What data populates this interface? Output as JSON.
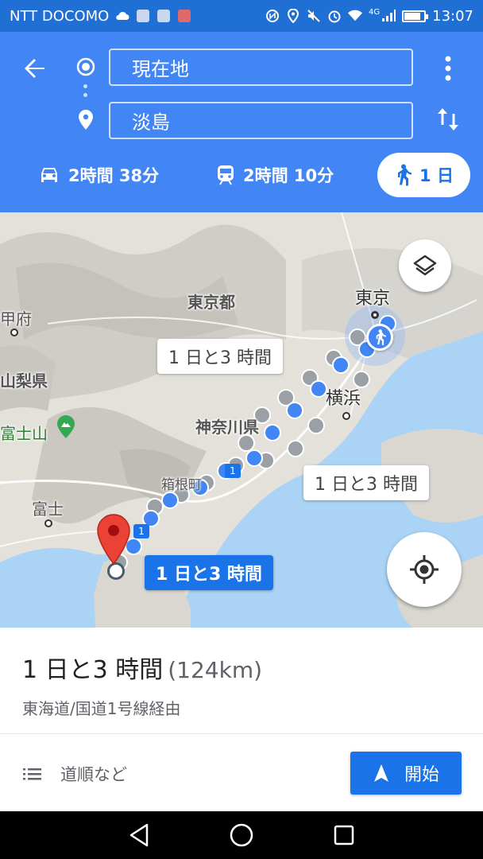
{
  "status_bar": {
    "carrier": "NTT DOCOMO",
    "network": "4G",
    "time": "13:07",
    "left_icons": [
      "cloud-icon",
      "app-icon",
      "app-icon",
      "mail-icon"
    ],
    "right_icons": [
      "nfc-icon",
      "location-icon",
      "mute-icon",
      "alarm-icon",
      "wifi-icon",
      "signal-icon",
      "battery-icon"
    ]
  },
  "header": {
    "origin": "現在地",
    "destination": "淡島",
    "modes": [
      {
        "icon": "car-icon",
        "label": "2時間 38分",
        "selected": false
      },
      {
        "icon": "train-icon",
        "label": "2時間 10分",
        "selected": false
      },
      {
        "icon": "walk-icon",
        "label": "1 日",
        "selected": true
      }
    ],
    "colors": {
      "header": "#4285f4",
      "status_bar": "#1f6fd4",
      "accent": "#1a73e8"
    }
  },
  "map": {
    "labels": {
      "tokyo": "東京",
      "tokyo_to": "東京都",
      "kofu": "甲府",
      "yamanashi": "山梨県",
      "yokohama": "横浜",
      "kanagawa": "神奈川県",
      "fujisan": "富士山",
      "hakone": "箱根町",
      "fuji": "富士"
    },
    "route_bubbles": [
      {
        "label": "1 日と3 時間",
        "active": false
      },
      {
        "label": "1 日と3 時間",
        "active": false
      },
      {
        "label": "1 日と3 時間",
        "active": true
      }
    ],
    "route_shield_label": "1",
    "buttons": {
      "layers": "layers-icon",
      "my_location": "my-location-icon"
    }
  },
  "sheet": {
    "duration": "1 日と3 時間",
    "distance": "(124km)",
    "via": "東海道/国道1号線経由",
    "steps_label": "道順など",
    "start_label": "開始"
  }
}
